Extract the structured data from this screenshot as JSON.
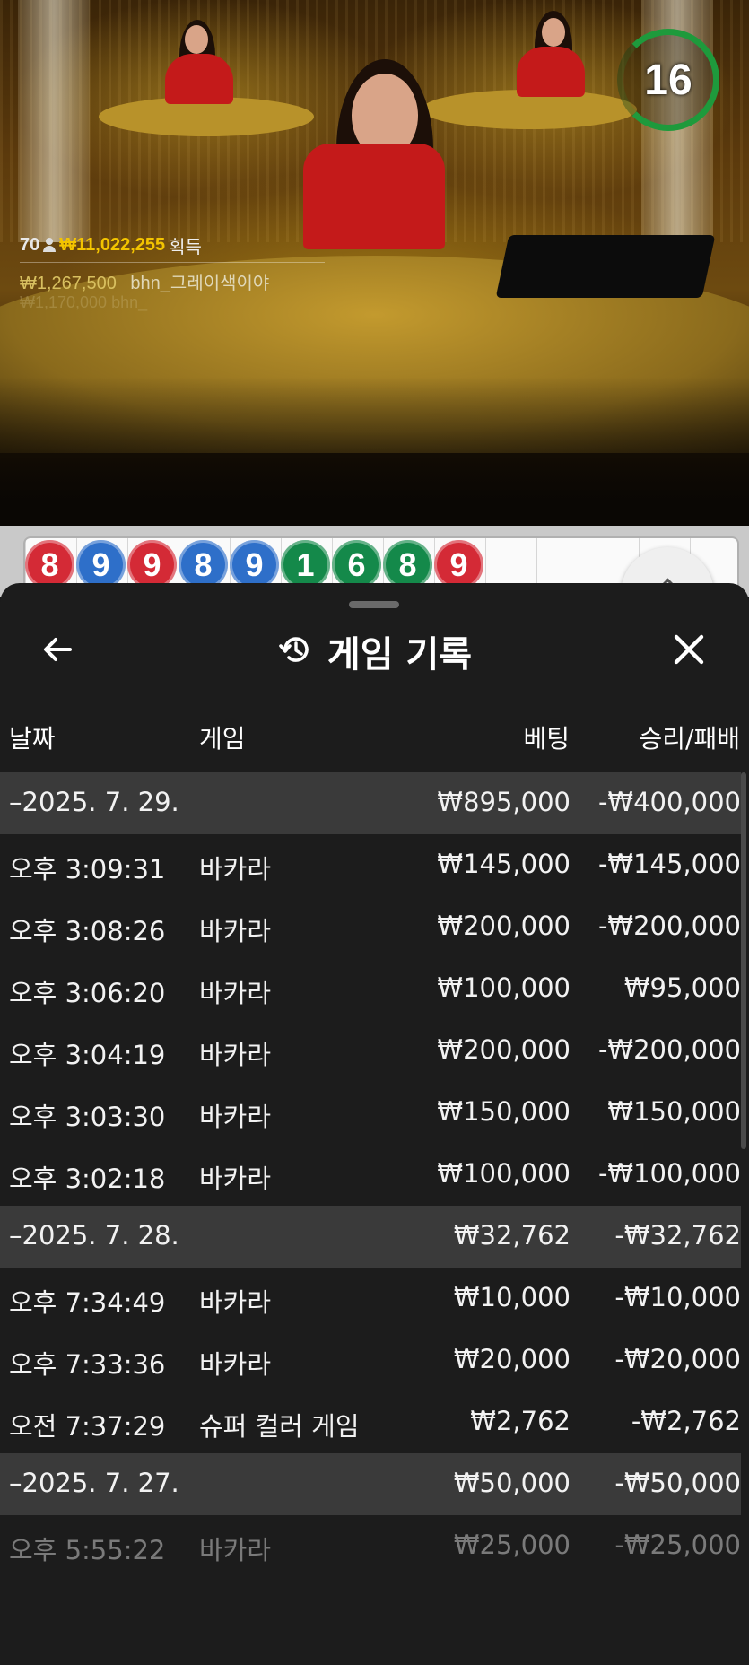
{
  "live": {
    "timer": "16",
    "winners": {
      "count": "70",
      "total": "₩11,022,255",
      "suffix": "획득",
      "top_amount": "₩1,267,500",
      "top_player": "bhn_그레이색이야",
      "faded_row": "₩1,170,000 bhn_"
    }
  },
  "roadmap": {
    "beads": [
      {
        "value": "8",
        "color": "red"
      },
      {
        "value": "9",
        "color": "blue"
      },
      {
        "value": "9",
        "color": "red"
      },
      {
        "value": "8",
        "color": "blue"
      },
      {
        "value": "9",
        "color": "blue"
      },
      {
        "value": "1",
        "color": "green"
      },
      {
        "value": "6",
        "color": "green"
      },
      {
        "value": "8",
        "color": "green"
      },
      {
        "value": "9",
        "color": "red"
      }
    ]
  },
  "panel": {
    "title": "게임 기록",
    "back_icon": "arrow-left-icon",
    "history_icon": "history-icon",
    "close_icon": "close-icon",
    "columns": {
      "date": "날짜",
      "game": "게임",
      "bet": "베팅",
      "result": "승리/패배"
    },
    "rows": [
      {
        "type": "group",
        "date": "–2025. 7. 29.",
        "game": "",
        "bet": "₩895,000",
        "result": "-₩400,000"
      },
      {
        "type": "item",
        "date": "오후 3:09:31",
        "game": "바카라",
        "bet": "₩145,000",
        "result": "-₩145,000"
      },
      {
        "type": "item",
        "date": "오후 3:08:26",
        "game": "바카라",
        "bet": "₩200,000",
        "result": "-₩200,000"
      },
      {
        "type": "item",
        "date": "오후 3:06:20",
        "game": "바카라",
        "bet": "₩100,000",
        "result": "₩95,000"
      },
      {
        "type": "item",
        "date": "오후 3:04:19",
        "game": "바카라",
        "bet": "₩200,000",
        "result": "-₩200,000"
      },
      {
        "type": "item",
        "date": "오후 3:03:30",
        "game": "바카라",
        "bet": "₩150,000",
        "result": "₩150,000"
      },
      {
        "type": "item",
        "date": "오후 3:02:18",
        "game": "바카라",
        "bet": "₩100,000",
        "result": "-₩100,000"
      },
      {
        "type": "group",
        "date": "–2025. 7. 28.",
        "game": "",
        "bet": "₩32,762",
        "result": "-₩32,762"
      },
      {
        "type": "item",
        "date": "오후 7:34:49",
        "game": "바카라",
        "bet": "₩10,000",
        "result": "-₩10,000"
      },
      {
        "type": "item",
        "date": "오후 7:33:36",
        "game": "바카라",
        "bet": "₩20,000",
        "result": "-₩20,000"
      },
      {
        "type": "item",
        "date": "오전 7:37:29",
        "game": "슈퍼 컬러 게임",
        "bet": "₩2,762",
        "result": "-₩2,762"
      },
      {
        "type": "group",
        "date": "–2025. 7. 27.",
        "game": "",
        "bet": "₩50,000",
        "result": "-₩50,000"
      },
      {
        "type": "item",
        "faded": true,
        "date": "오후 5:55:22",
        "game": "바카라",
        "bet": "₩25,000",
        "result": "-₩25,000"
      }
    ]
  }
}
